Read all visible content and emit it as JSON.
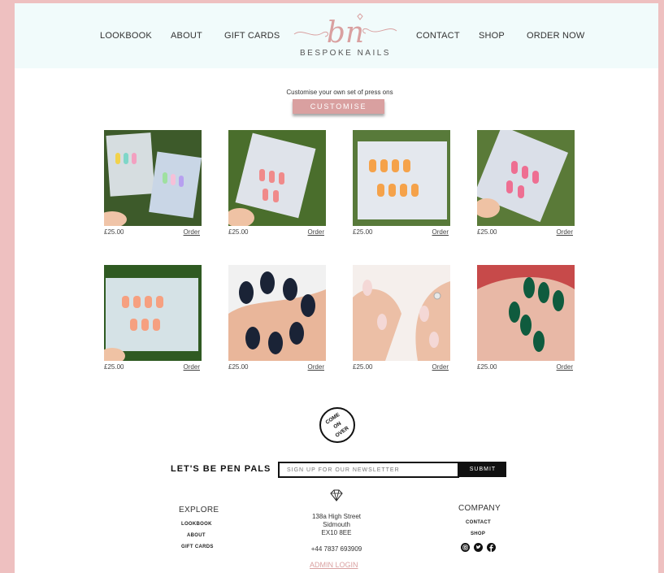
{
  "nav": {
    "left": [
      "LOOKBOOK",
      "ABOUT",
      "GIFT CARDS"
    ],
    "right": [
      "CONTACT",
      "SHOP",
      "ORDER NOW"
    ]
  },
  "logo": {
    "monogram": "bn",
    "name": "BESPOKE NAILS"
  },
  "customise": {
    "lead": "Customise your own set of press ons",
    "button": "CUSTOMISE"
  },
  "products": [
    {
      "price": "£25.00",
      "order": "Order"
    },
    {
      "price": "£25.00",
      "order": "Order"
    },
    {
      "price": "£25.00",
      "order": "Order"
    },
    {
      "price": "£25.00",
      "order": "Order"
    },
    {
      "price": "£25.00",
      "order": "Order"
    },
    {
      "price": "£25.00",
      "order": "Order"
    },
    {
      "price": "£25.00",
      "order": "Order"
    },
    {
      "price": "£25.00",
      "order": "Order"
    }
  ],
  "badge": {
    "words": [
      "COME",
      "ON",
      "OVER"
    ]
  },
  "newsletter": {
    "heading": "LET'S BE PEN PALS",
    "placeholder": "SIGN UP FOR OUR NEWSLETTER",
    "submit": "SUBMIT"
  },
  "footer": {
    "explore": {
      "heading": "EXPLORE",
      "links": [
        "LOOKBOOK",
        "ABOUT",
        "GIFT CARDS"
      ]
    },
    "address": {
      "line1": "138a High Street",
      "line2": "Sidmouth",
      "line3": "EX10 8EE",
      "phone": "+44 7837 693909",
      "admin": "ADMIN LOGIN"
    },
    "company": {
      "heading": "COMPANY",
      "links": [
        "CONTACT",
        "SHOP"
      ]
    },
    "social_icons": [
      "instagram-icon",
      "twitter-icon",
      "facebook-icon"
    ]
  },
  "colors": {
    "accent": "#d9a0a0",
    "border": "#eec0c0",
    "header_bg": "#f1fbfb"
  }
}
